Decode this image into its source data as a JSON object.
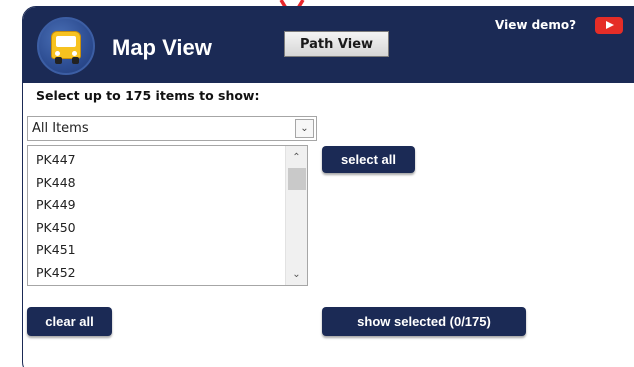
{
  "header": {
    "title": "Map View",
    "path_button_label": "Path View",
    "demo_text": "View demo?",
    "icons": {
      "app": "bus-icon",
      "video": "youtube-play-icon",
      "pointer": "arrow-down-icon"
    },
    "colors": {
      "header_bg": "#1b2a55",
      "bus": "#f7c21f",
      "video": "#e52d27",
      "pointer": "#e8262b"
    }
  },
  "selection": {
    "label": "Select up to 175 items to show:",
    "dropdown_value": "All Items",
    "items": [
      "PK447",
      "PK448",
      "PK449",
      "PK450",
      "PK451",
      "PK452"
    ]
  },
  "actions": {
    "select_all": "select all",
    "clear_all": "clear all",
    "show_selected": "show selected (0/175)"
  }
}
